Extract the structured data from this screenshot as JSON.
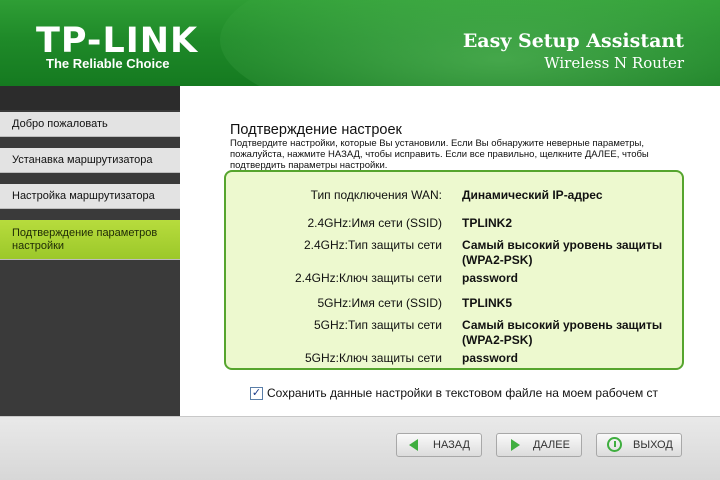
{
  "header": {
    "logo": "TP-LINK",
    "tagline": "The Reliable Choice",
    "title": "Easy Setup Assistant",
    "subtitle": "Wireless N Router"
  },
  "sidebar": {
    "items": [
      {
        "label": "Добро пожаловать",
        "active": false
      },
      {
        "label": "Устанавка маршрутизатора",
        "active": false
      },
      {
        "label": "Настройка маршрутизатора",
        "active": false
      },
      {
        "label": "Подтверждение параметров настройки",
        "active": true
      }
    ]
  },
  "main": {
    "title": "Подтверждение настроек",
    "description": "Подтвердите настройки, которые Вы установили. Если Вы обнаружите неверные параметры, пожалуйста, нажмите НАЗАД, чтобы исправить. Если все правильно, щелкните ДАЛЕЕ, чтобы подтвердить параметры настройки.",
    "summary": [
      {
        "label": "Тип подключения WAN:",
        "value": "Динамический IP-адрес"
      },
      {
        "label": "2.4GHz:Имя сети (SSID)",
        "value": "TPLINK2"
      },
      {
        "label": "2.4GHz:Тип защиты сети",
        "value": "Самый высокий уровень защиты (WPA2-PSK)"
      },
      {
        "label": "2.4GHz:Ключ защиты сети",
        "value": "password"
      },
      {
        "label": "5GHz:Имя сети (SSID)",
        "value": "TPLINK5"
      },
      {
        "label": "5GHz:Тип защиты сети",
        "value": "Самый высокий уровень защиты (WPA2-PSK)"
      },
      {
        "label": "5GHz:Ключ защиты сети",
        "value": "password"
      }
    ],
    "save_checkbox": {
      "checked": true,
      "label": "Сохранить данные настройки в текстовом файле на моем рабочем ст"
    }
  },
  "footer": {
    "back_label": "НАЗАД",
    "next_label": "ДАЛЕЕ",
    "exit_label": "ВЫХОД"
  },
  "colors": {
    "header_green": "#1f8a29",
    "active_item": "#a8d232",
    "summary_bg": "#edf9cf",
    "summary_border": "#56a52e"
  }
}
